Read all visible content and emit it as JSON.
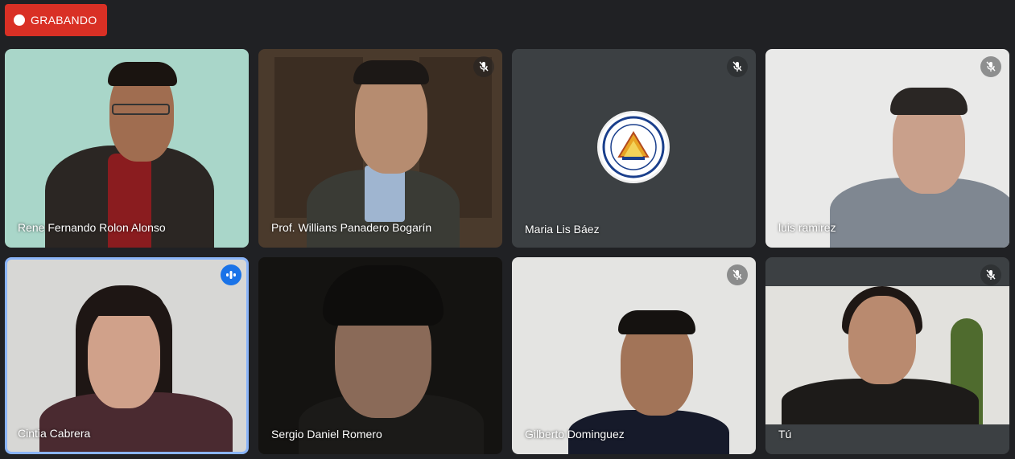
{
  "recording": {
    "label": "GRABANDO",
    "color": "#d93025"
  },
  "participants": [
    {
      "name": "Rene Fernando Rolon Alonso",
      "muted": false
    },
    {
      "name": "Prof. Willians Panadero Bogarín",
      "muted": true
    },
    {
      "name": "Maria Lis Báez",
      "muted": true
    },
    {
      "name": "luis ramirez",
      "muted": true
    },
    {
      "name": "Cintia Cabrera",
      "muted": false,
      "speaking": true
    },
    {
      "name": "Sergio Daniel Romero",
      "muted": false
    },
    {
      "name": "Gilberto Dominguez",
      "muted": true
    },
    {
      "name": "Tú",
      "muted": true
    }
  ],
  "icons": {
    "recording": "record-dot-icon",
    "muted": "mic-off-icon",
    "speaking": "audio-level-icon"
  },
  "colors": {
    "background": "#202124",
    "speaking_border": "#8ab4f8",
    "speaking_badge": "#1a73e8"
  }
}
